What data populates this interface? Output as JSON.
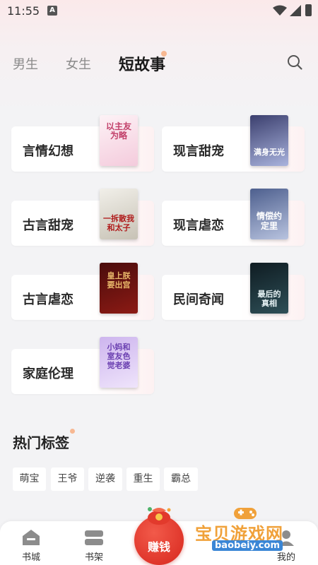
{
  "status": {
    "time": "11:55",
    "notif_letter": "A"
  },
  "tabs": [
    {
      "label": "男生"
    },
    {
      "label": "女生"
    },
    {
      "label": "短故事"
    }
  ],
  "categories": [
    {
      "label": "言情幻想",
      "cover_text": "以主友为略",
      "cover_colors": [
        "#fdf2f6",
        "#f4cbdc"
      ],
      "cover_text_color": "#c2406a"
    },
    {
      "label": "现言甜宠",
      "cover_text": "满身无光",
      "cover_colors": [
        "#3b3f6e",
        "#a9b3dd"
      ],
      "cover_text_color": "#ffffff"
    },
    {
      "label": "古言甜宠",
      "cover_text": "一拆散我和太子",
      "cover_colors": [
        "#f1efe9",
        "#c7c2b5"
      ],
      "cover_text_color": "#b01c1c"
    },
    {
      "label": "现言虐恋",
      "cover_text": "情偿约定里",
      "cover_colors": [
        "#4d5f8e",
        "#b8c3df"
      ],
      "cover_text_color": "#ffffff"
    },
    {
      "label": "古言虐恋",
      "cover_text": "皇上朕要出宫",
      "cover_colors": [
        "#4a0c0c",
        "#8c1a14"
      ],
      "cover_text_color": "#e8b86a"
    },
    {
      "label": "民间奇闻",
      "cover_text": "最后的真相",
      "cover_colors": [
        "#0f1c22",
        "#2e4f57"
      ],
      "cover_text_color": "#e6f2f4"
    },
    {
      "label": "家庭伦理",
      "cover_text": "小妈和室友色觉老婆",
      "cover_colors": [
        "#cdb5ee",
        "#efe4fb"
      ],
      "cover_text_color": "#6a3fb0"
    }
  ],
  "hot_tags": {
    "title": "热门标签",
    "items": [
      {
        "label": "萌宝"
      },
      {
        "label": "王爷"
      },
      {
        "label": "逆袭"
      },
      {
        "label": "重生"
      },
      {
        "label": "霸总"
      }
    ]
  },
  "bottom_nav": {
    "items": [
      {
        "label": "书城",
        "icon": "bookstore-icon"
      },
      {
        "label": "书架",
        "icon": "bookshelf-icon"
      },
      {
        "label": "我的",
        "icon": "profile-icon"
      }
    ],
    "earn_label": "赚钱"
  },
  "watermark": {
    "text": "宝贝游戏网",
    "url": "baobeiy.com"
  },
  "colors": {
    "accent": "#e03b2d",
    "dot": "#f7b892",
    "watermark": "#f0a13a"
  }
}
